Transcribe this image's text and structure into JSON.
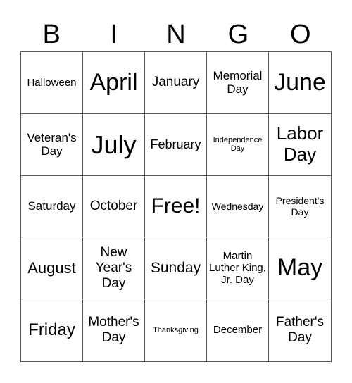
{
  "header": [
    "B",
    "I",
    "N",
    "G",
    "O"
  ],
  "cells": [
    "Halloween",
    "April",
    "January",
    "Memorial Day",
    "June",
    "Veteran's Day",
    "July",
    "February",
    "Independence Day",
    "Labor Day",
    "Saturday",
    "October",
    "Free!",
    "Wednesday",
    "President's Day",
    "August",
    "New Year's Day",
    "Sunday",
    "Martin Luther King, Jr. Day",
    "May",
    "Friday",
    "Mother's Day",
    "Thanksgiving",
    "December",
    "Father's Day"
  ]
}
